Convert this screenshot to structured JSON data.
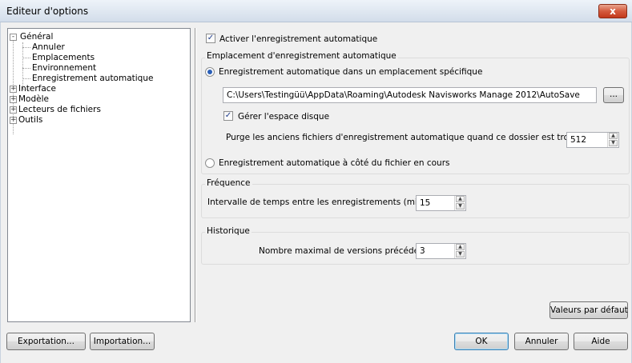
{
  "window": {
    "title": "Editeur d'options",
    "close_glyph": "x"
  },
  "tree": {
    "items": [
      {
        "label": "Général",
        "expander": "-"
      },
      {
        "label": "Annuler"
      },
      {
        "label": "Emplacements"
      },
      {
        "label": "Environnement"
      },
      {
        "label": "Enregistrement automatique"
      },
      {
        "label": "Interface",
        "expander": "+"
      },
      {
        "label": "Modèle",
        "expander": "+"
      },
      {
        "label": "Lecteurs de fichiers",
        "expander": "+"
      },
      {
        "label": "Outils",
        "expander": "+"
      }
    ]
  },
  "autosave": {
    "enable_label": "Activer l'enregistrement automatique",
    "enable_checked": true,
    "location_group_title": "Emplacement d'enregistrement automatique",
    "specific_location_label": "Enregistrement automatique dans un emplacement spécifique",
    "path_value": "C:\\Users\\Testingüü\\AppData\\Roaming\\Autodesk Navisworks Manage 2012\\AutoSave",
    "browse_label": "...",
    "manage_disk_label": "Gérer l'espace disque",
    "manage_disk_checked": true,
    "purge_label": "Purge les anciens fichiers d'enregistrement automatique quand ce dossier est trop plein (Mo)",
    "purge_value": "512",
    "beside_file_label": "Enregistrement automatique à côté du fichier en cours"
  },
  "frequency": {
    "title": "Fréquence",
    "interval_label": "Intervalle de temps entre les enregistrements (minutes)",
    "interval_value": "15"
  },
  "history": {
    "title": "Historique",
    "max_versions_label": "Nombre maximal de versions précédentes",
    "max_versions_value": "3"
  },
  "buttons": {
    "defaults": "Valeurs par défaut",
    "export": "Exportation...",
    "import": "Importation...",
    "ok": "OK",
    "cancel": "Annuler",
    "help": "Aide"
  },
  "icons": {
    "check": "✓",
    "spin_up": "▲",
    "spin_down": "▼"
  }
}
